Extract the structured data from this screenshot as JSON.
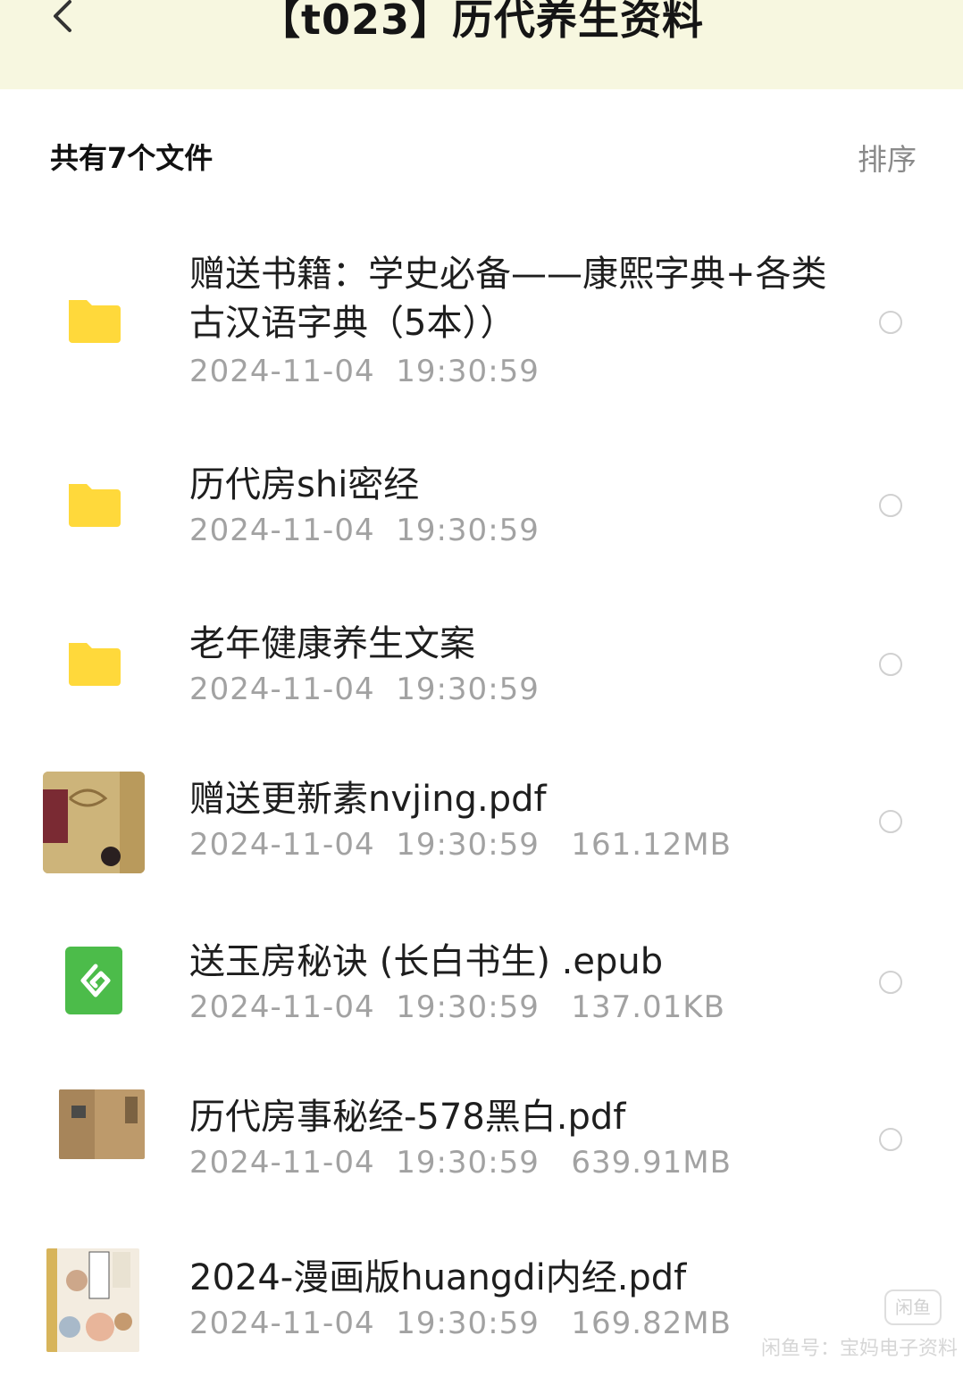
{
  "header": {
    "title": "【t023】历代养生资料"
  },
  "list_header": {
    "count_label": "共有7个文件",
    "sort_label": "排序"
  },
  "files": [
    {
      "name": "赠送书籍：学史必备——康熙字典+各类古汉语字典（5本））",
      "meta": "2024-11-04  19:30:59",
      "icon": "folder-icon"
    },
    {
      "name": "历代房shi密经",
      "meta": "2024-11-04  19:30:59",
      "icon": "folder-icon"
    },
    {
      "name": "老年健康养生文案",
      "meta": "2024-11-04  19:30:59",
      "icon": "folder-icon"
    },
    {
      "name": "赠送更新素nvjing.pdf",
      "meta": "2024-11-04  19:30:59   161.12MB",
      "icon": "pdf-thumbnail"
    },
    {
      "name": "送玉房秘诀 (长白书生) .epub",
      "meta": "2024-11-04  19:30:59   137.01KB",
      "icon": "epub-icon"
    },
    {
      "name": "历代房事秘经-578黑白.pdf",
      "meta": "2024-11-04  19:30:59   639.91MB",
      "icon": "pdf-thumbnail"
    },
    {
      "name": "2024-漫画版huangdi内经.pdf",
      "meta": "2024-11-04  19:30:59   169.82MB",
      "icon": "pdf-thumbnail"
    }
  ],
  "watermark": {
    "line1": "闲鱼号：宝妈电子资料",
    "badge": "闲鱼"
  },
  "colors": {
    "header_bg": "#f7f7e0",
    "folder": "#ffd93b",
    "epub": "#4cbc4a"
  }
}
